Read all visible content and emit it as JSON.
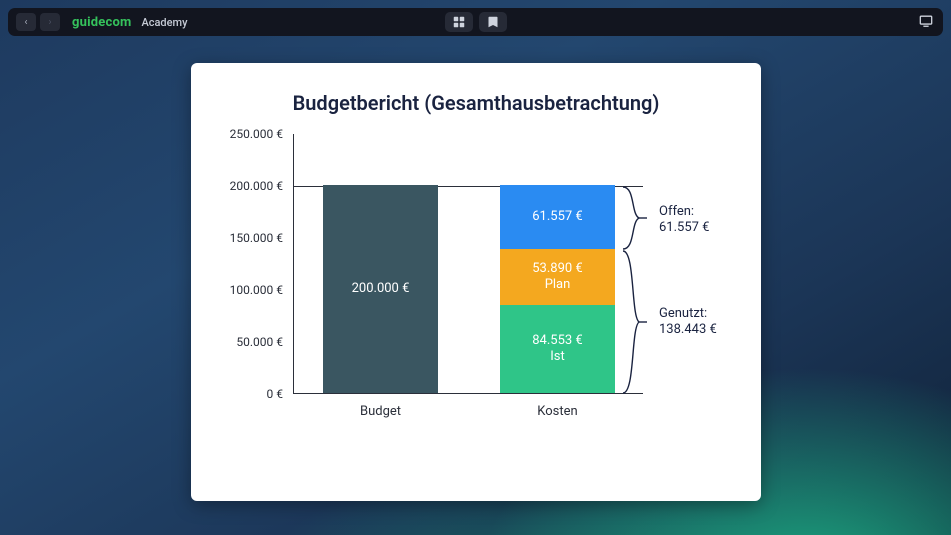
{
  "topbar": {
    "brand": "guidecom",
    "brand_sub": "Academy"
  },
  "card": {
    "title": "Budgetbericht (Gesamthausbetrachtung)"
  },
  "chart_data": {
    "type": "bar",
    "title": "Budgetbericht (Gesamthausbetrachtung)",
    "ylabel": "€",
    "ylim": [
      0,
      250000
    ],
    "yticks": [
      0,
      50000,
      100000,
      150000,
      200000,
      250000
    ],
    "ytick_labels": [
      "0 €",
      "50.000 €",
      "100.000 €",
      "150.000 €",
      "200.000 €",
      "250.000 €"
    ],
    "categories": [
      "Budget",
      "Kosten"
    ],
    "series": [
      {
        "name": "Budget",
        "values": [
          200000,
          null
        ],
        "color": "#3a5661",
        "label": "200.000 €"
      },
      {
        "name": "Ist",
        "values": [
          null,
          84553
        ],
        "color": "#2fc588",
        "label": "84.553 €"
      },
      {
        "name": "Plan",
        "values": [
          null,
          53890
        ],
        "color": "#f4a81f",
        "label": "53.890 €"
      },
      {
        "name": "Offen",
        "values": [
          null,
          61557
        ],
        "color": "#2a8bf2",
        "label": "61.557 €"
      }
    ],
    "annotations": {
      "offen": {
        "label": "Offen:",
        "value_label": "61.557 €",
        "value": 61557
      },
      "genutzt": {
        "label": "Genutzt:",
        "value_label": "138.443 €",
        "value": 138443
      }
    },
    "reference_line_at": 200000
  },
  "labels": {
    "budget_bar": "200.000 €",
    "kosten_ist_val": "84.553 €",
    "kosten_ist_name": "Ist",
    "kosten_plan_val": "53.890 €",
    "kosten_plan_name": "Plan",
    "kosten_off_val": "61.557 €",
    "cat_budget": "Budget",
    "cat_kosten": "Kosten",
    "ann_off_lbl": "Offen:",
    "ann_off_val": "61.557 €",
    "ann_gen_lbl": "Genutzt:",
    "ann_gen_val": "138.443 €"
  }
}
